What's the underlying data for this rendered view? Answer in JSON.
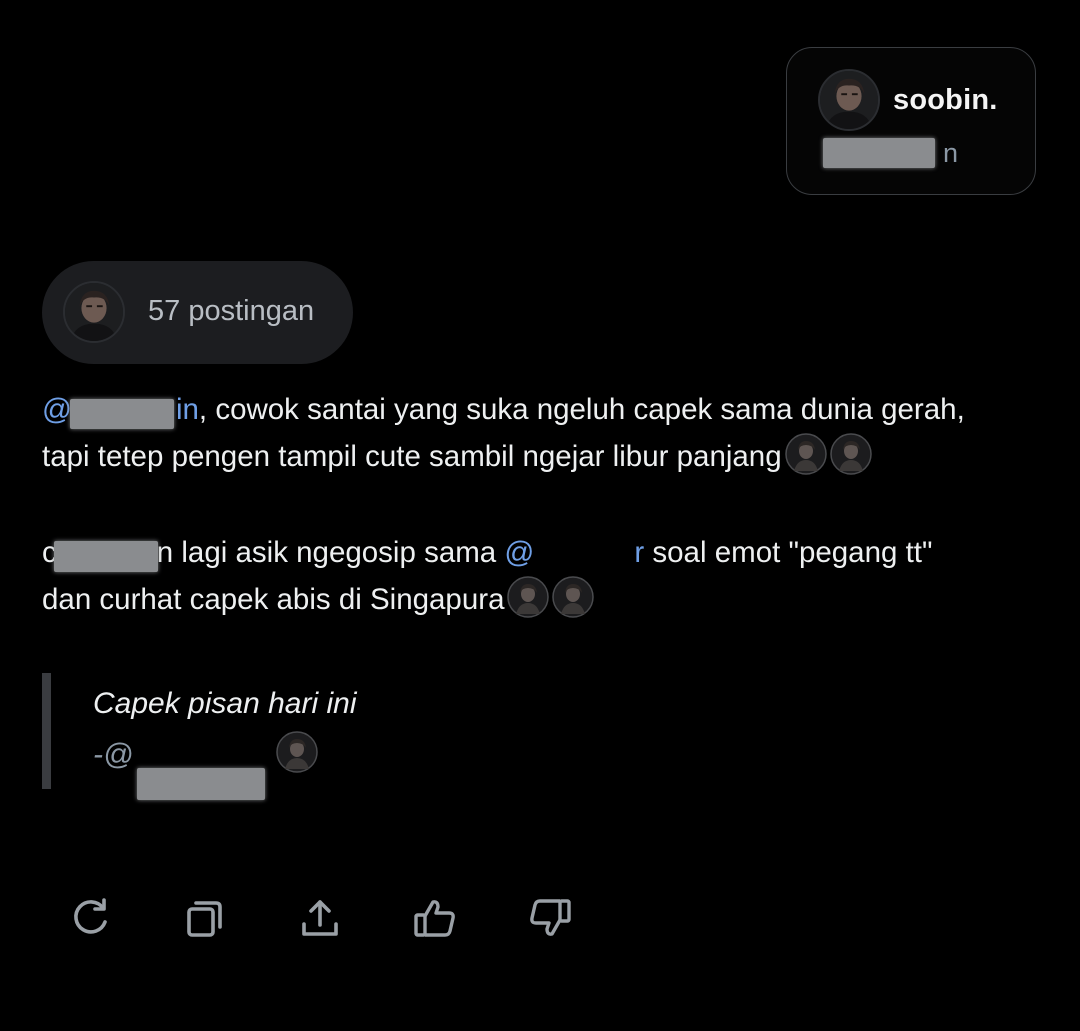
{
  "profile_card": {
    "name": "soobin.",
    "handle_visible_suffix": "n"
  },
  "posts_pill": {
    "label": "57 postingan"
  },
  "description": {
    "paragraph1": {
      "mention_prefix": "@",
      "mention_suffix": "in",
      "line1_rest": ", cowok santai yang suka ngeluh capek sama dunia gerah,",
      "line2": "tapi tetep pengen tampil cute sambil ngejar libur panjang"
    },
    "paragraph2": {
      "lead_prefix": "c",
      "lead_suffix": "n",
      "middle": " lagi asik ngegosip sama ",
      "mention_prefix": "@",
      "mention_suffix": "r",
      "line1_rest": " soal emot \"pegang tt\"",
      "line2": "dan curhat capek abis di Singapura"
    }
  },
  "quote": {
    "text": "Capek pisan hari ini",
    "attribution_prefix": "-@"
  },
  "actions": {
    "icons": [
      "refresh-icon",
      "copy-icon",
      "share-icon",
      "thumbs-up-icon",
      "thumbs-down-icon"
    ]
  },
  "colors": {
    "background": "#000000",
    "mention": "#6f9fe6",
    "pill_bg": "#1c1d20",
    "text": "#eef0f1",
    "muted": "#8b98a5"
  }
}
